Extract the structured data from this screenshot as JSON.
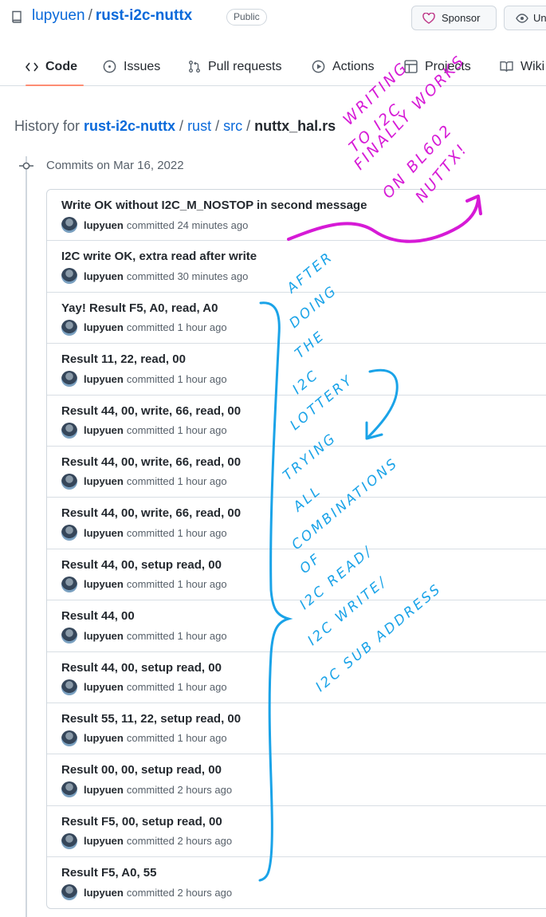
{
  "repo": {
    "owner": "lupyuen",
    "separator": "/",
    "name": "rust-i2c-nuttx",
    "visibility": "Public"
  },
  "actions": {
    "sponsor_label": "Sponsor",
    "watch_label": "Un"
  },
  "tabs": [
    {
      "label": "Code",
      "icon": "code-icon",
      "active": true
    },
    {
      "label": "Issues",
      "icon": "issue-icon"
    },
    {
      "label": "Pull requests",
      "icon": "pull-request-icon"
    },
    {
      "label": "Actions",
      "icon": "play-icon"
    },
    {
      "label": "Projects",
      "icon": "table-icon"
    },
    {
      "label": "Wiki",
      "icon": "book-icon"
    }
  ],
  "breadcrumb": {
    "prefix": "History for",
    "repo": "rust-i2c-nuttx",
    "dir1": "rust",
    "dir2": "src",
    "file": "nuttx_hal.rs",
    "sep": "/"
  },
  "commits_date": "Commits on Mar 16, 2022",
  "commits": [
    {
      "title": "Write OK without I2C_M_NOSTOP in second message",
      "author": "lupyuen",
      "action": "committed",
      "time": "24 minutes ago"
    },
    {
      "title": "I2C write OK, extra read after write",
      "author": "lupyuen",
      "action": "committed",
      "time": "30 minutes ago"
    },
    {
      "title": "Yay! Result F5, A0, read, A0",
      "author": "lupyuen",
      "action": "committed",
      "time": "1 hour ago"
    },
    {
      "title": "Result 11, 22, read, 00",
      "author": "lupyuen",
      "action": "committed",
      "time": "1 hour ago"
    },
    {
      "title": "Result 44, 00, write, 66, read, 00",
      "author": "lupyuen",
      "action": "committed",
      "time": "1 hour ago"
    },
    {
      "title": "Result 44, 00, write, 66, read, 00",
      "author": "lupyuen",
      "action": "committed",
      "time": "1 hour ago"
    },
    {
      "title": "Result 44, 00, write, 66, read, 00",
      "author": "lupyuen",
      "action": "committed",
      "time": "1 hour ago"
    },
    {
      "title": "Result 44, 00, setup read, 00",
      "author": "lupyuen",
      "action": "committed",
      "time": "1 hour ago"
    },
    {
      "title": "Result 44, 00",
      "author": "lupyuen",
      "action": "committed",
      "time": "1 hour ago"
    },
    {
      "title": "Result 44, 00, setup read, 00",
      "author": "lupyuen",
      "action": "committed",
      "time": "1 hour ago"
    },
    {
      "title": "Result 55, 11, 22, setup read, 00",
      "author": "lupyuen",
      "action": "committed",
      "time": "1 hour ago"
    },
    {
      "title": "Result 00, 00, setup read, 00",
      "author": "lupyuen",
      "action": "committed",
      "time": "2 hours ago"
    },
    {
      "title": "Result F5, 00, setup read, 00",
      "author": "lupyuen",
      "action": "committed",
      "time": "2 hours ago"
    },
    {
      "title": "Result F5, A0, 55",
      "author": "lupyuen",
      "action": "committed",
      "time": "2 hours ago"
    }
  ],
  "annotations": {
    "magenta_color": "#d61ad6",
    "blue_color": "#1aa3e8",
    "magenta_lines": [
      "WRITING",
      "TO I2C",
      "FINALLY WORKS",
      "ON BL602",
      "NUTTX!"
    ],
    "blue_lines_top": [
      "AFTER",
      "DOING",
      "THE",
      "I2C",
      "LOTTERY"
    ],
    "blue_lines_bottom": [
      "TRYING",
      "ALL",
      "COMBINATIONS",
      "OF",
      "I2C READ/",
      "I2C WRITE/",
      "I2C SUB ADDRESS"
    ]
  }
}
